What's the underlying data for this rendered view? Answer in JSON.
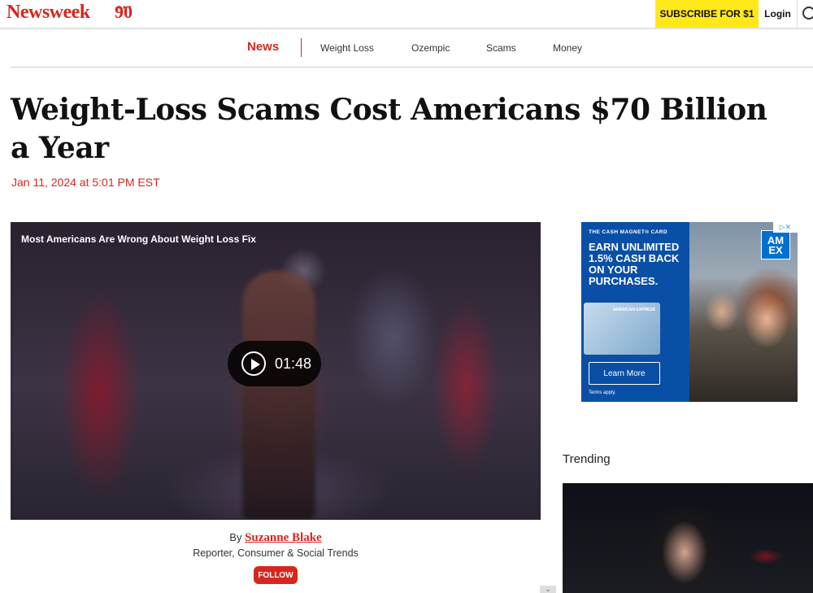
{
  "header": {
    "logo": "Newsweek",
    "logo_badge": "90",
    "logo_stars": "★★★",
    "subscribe_label": "SUBSCRIBE FOR $1",
    "login_label": "Login"
  },
  "nav": {
    "active": "News",
    "items": [
      "Weight Loss",
      "Ozempic",
      "Scams",
      "Money"
    ]
  },
  "article": {
    "title": "Weight-Loss Scams Cost Americans $70 Billion a Year",
    "date": "Jan 11, 2024 at 5:01 PM EST",
    "video": {
      "title": "Most Americans Are Wrong About Weight Loss Fix",
      "duration": "01:48"
    },
    "byline_prefix": "By",
    "author": "Suzanne Blake",
    "author_role": "Reporter, Consumer & Social Trends",
    "follow_label": "FOLLOW"
  },
  "ad": {
    "card_label": "THE CASH MAGNET® CARD",
    "headline": "EARN UNLIMITED 1.5% CASH BACK ON YOUR PURCHASES.",
    "card_text": "AMERICAN EXPRESS",
    "cta": "Learn More",
    "terms": "Terms apply.",
    "logo": "AM EX"
  },
  "sidebar": {
    "trending_label": "Trending"
  }
}
